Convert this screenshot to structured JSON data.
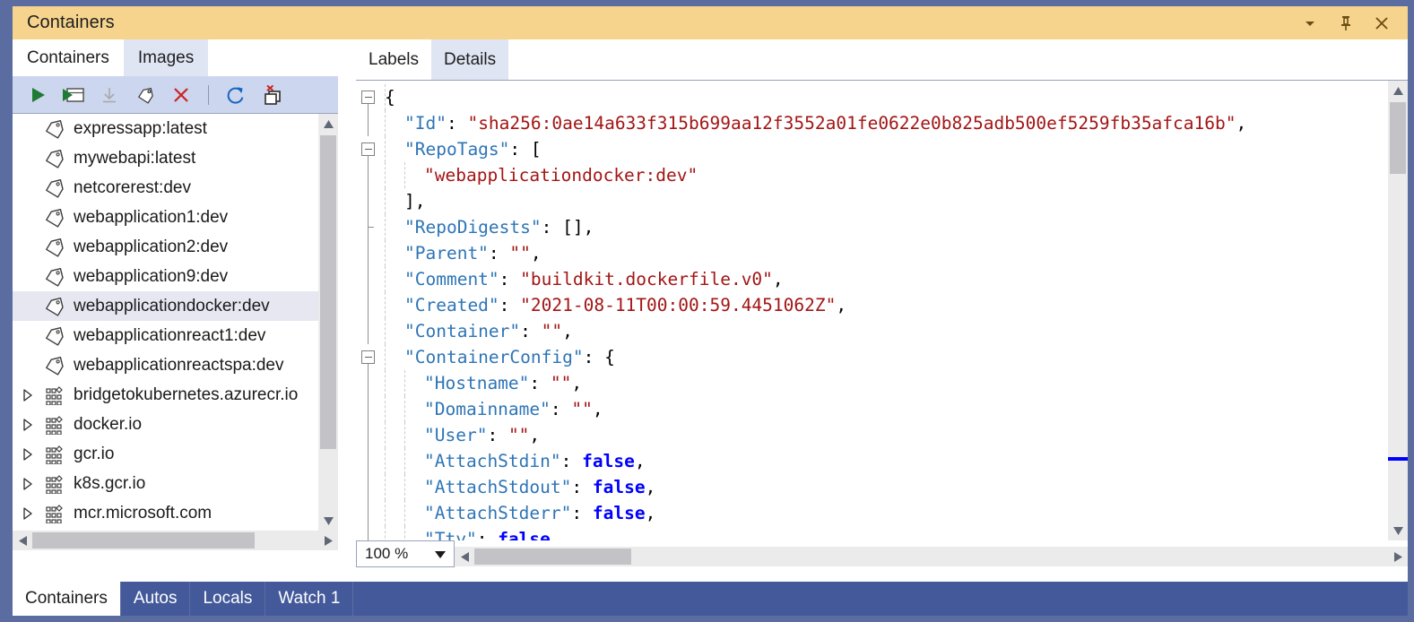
{
  "window": {
    "title": "Containers",
    "controls": [
      {
        "name": "window-dropdown-icon",
        "glyph": "chevron-down-icon",
        "label": "Window options"
      },
      {
        "name": "pin-icon",
        "glyph": "pin-icon",
        "label": "Auto Hide"
      },
      {
        "name": "close-icon",
        "glyph": "close-icon",
        "label": "Close"
      }
    ]
  },
  "left_panel": {
    "tabs": [
      {
        "label": "Containers",
        "active": false
      },
      {
        "label": "Images",
        "active": true
      }
    ],
    "toolbar": [
      {
        "name": "run-button",
        "icon": "play-icon",
        "label": "Run",
        "enabled": true
      },
      {
        "name": "run-interactive-button",
        "icon": "play-window-icon",
        "label": "Run interactive",
        "enabled": true
      },
      {
        "name": "pull-button",
        "icon": "download-arrow-icon",
        "label": "Pull",
        "enabled": false
      },
      {
        "name": "tag-button",
        "icon": "tag-icon",
        "label": "Tag",
        "enabled": true
      },
      {
        "name": "remove-button",
        "icon": "red-x-icon",
        "label": "Remove",
        "enabled": true
      },
      {
        "name": "separator",
        "icon": "separator",
        "label": "",
        "enabled": true
      },
      {
        "name": "refresh-button",
        "icon": "refresh-icon",
        "label": "Refresh",
        "enabled": true
      },
      {
        "name": "prune-button",
        "icon": "prune-images-icon",
        "label": "Prune images",
        "enabled": true
      }
    ],
    "tree": [
      {
        "label": "expressapp:latest",
        "icon": "tag-icon",
        "expandable": false,
        "selected": false
      },
      {
        "label": "mywebapi:latest",
        "icon": "tag-icon",
        "expandable": false,
        "selected": false
      },
      {
        "label": "netcorerest:dev",
        "icon": "tag-icon",
        "expandable": false,
        "selected": false
      },
      {
        "label": "webapplication1:dev",
        "icon": "tag-icon",
        "expandable": false,
        "selected": false
      },
      {
        "label": "webapplication2:dev",
        "icon": "tag-icon",
        "expandable": false,
        "selected": false
      },
      {
        "label": "webapplication9:dev",
        "icon": "tag-icon",
        "expandable": false,
        "selected": false
      },
      {
        "label": "webapplicationdocker:dev",
        "icon": "tag-icon",
        "expandable": false,
        "selected": true
      },
      {
        "label": "webapplicationreact1:dev",
        "icon": "tag-icon",
        "expandable": false,
        "selected": false
      },
      {
        "label": "webapplicationreactspa:dev",
        "icon": "tag-icon",
        "expandable": false,
        "selected": false
      },
      {
        "label": "bridgetokubernetes.azurecr.io",
        "icon": "registry-icon",
        "expandable": true,
        "selected": false
      },
      {
        "label": "docker.io",
        "icon": "registry-icon",
        "expandable": true,
        "selected": false
      },
      {
        "label": "gcr.io",
        "icon": "registry-icon",
        "expandable": true,
        "selected": false
      },
      {
        "label": "k8s.gcr.io",
        "icon": "registry-icon",
        "expandable": true,
        "selected": false
      },
      {
        "label": "mcr.microsoft.com",
        "icon": "registry-icon",
        "expandable": true,
        "selected": false
      }
    ]
  },
  "right_panel": {
    "tabs": [
      {
        "label": "Labels",
        "active": false
      },
      {
        "label": "Details",
        "active": true
      }
    ],
    "zoom": {
      "value": "100 %",
      "options": [
        "100 %"
      ]
    },
    "code_lines": [
      {
        "indent": 0,
        "glyph": "minus",
        "tokens": [
          {
            "t": "{",
            "c": "p"
          }
        ]
      },
      {
        "indent": 1,
        "glyph": "line",
        "tokens": [
          {
            "t": "\"Id\"",
            "c": "k"
          },
          {
            "t": ": ",
            "c": "p"
          },
          {
            "t": "\"sha256:0ae14a633f315b699aa12f3552a01fe0622e0b825adb500ef5259fb35afca16b\"",
            "c": "s"
          },
          {
            "t": ",",
            "c": "p"
          }
        ]
      },
      {
        "indent": 1,
        "glyph": "minus",
        "tokens": [
          {
            "t": "\"RepoTags\"",
            "c": "k"
          },
          {
            "t": ": [",
            "c": "p"
          }
        ]
      },
      {
        "indent": 2,
        "glyph": "line",
        "tokens": [
          {
            "t": "\"webapplicationdocker:dev\"",
            "c": "s"
          }
        ]
      },
      {
        "indent": 1,
        "glyph": "line",
        "tokens": [
          {
            "t": "],",
            "c": "p"
          }
        ]
      },
      {
        "indent": 1,
        "glyph": "tick",
        "tokens": [
          {
            "t": "\"RepoDigests\"",
            "c": "k"
          },
          {
            "t": ": [],",
            "c": "p"
          }
        ]
      },
      {
        "indent": 1,
        "glyph": "line",
        "tokens": [
          {
            "t": "\"Parent\"",
            "c": "k"
          },
          {
            "t": ": ",
            "c": "p"
          },
          {
            "t": "\"\"",
            "c": "s"
          },
          {
            "t": ",",
            "c": "p"
          }
        ]
      },
      {
        "indent": 1,
        "glyph": "line",
        "tokens": [
          {
            "t": "\"Comment\"",
            "c": "k"
          },
          {
            "t": ": ",
            "c": "p"
          },
          {
            "t": "\"buildkit.dockerfile.v0\"",
            "c": "s"
          },
          {
            "t": ",",
            "c": "p"
          }
        ]
      },
      {
        "indent": 1,
        "glyph": "line",
        "tokens": [
          {
            "t": "\"Created\"",
            "c": "k"
          },
          {
            "t": ": ",
            "c": "p"
          },
          {
            "t": "\"2021-08-11T00:00:59.4451062Z\"",
            "c": "s"
          },
          {
            "t": ",",
            "c": "p"
          }
        ]
      },
      {
        "indent": 1,
        "glyph": "line",
        "tokens": [
          {
            "t": "\"Container\"",
            "c": "k"
          },
          {
            "t": ": ",
            "c": "p"
          },
          {
            "t": "\"\"",
            "c": "s"
          },
          {
            "t": ",",
            "c": "p"
          }
        ]
      },
      {
        "indent": 1,
        "glyph": "minus",
        "tokens": [
          {
            "t": "\"ContainerConfig\"",
            "c": "k"
          },
          {
            "t": ": {",
            "c": "p"
          }
        ]
      },
      {
        "indent": 2,
        "glyph": "line",
        "tokens": [
          {
            "t": "\"Hostname\"",
            "c": "k"
          },
          {
            "t": ": ",
            "c": "p"
          },
          {
            "t": "\"\"",
            "c": "s"
          },
          {
            "t": ",",
            "c": "p"
          }
        ]
      },
      {
        "indent": 2,
        "glyph": "line",
        "tokens": [
          {
            "t": "\"Domainname\"",
            "c": "k"
          },
          {
            "t": ": ",
            "c": "p"
          },
          {
            "t": "\"\"",
            "c": "s"
          },
          {
            "t": ",",
            "c": "p"
          }
        ]
      },
      {
        "indent": 2,
        "glyph": "line",
        "tokens": [
          {
            "t": "\"User\"",
            "c": "k"
          },
          {
            "t": ": ",
            "c": "p"
          },
          {
            "t": "\"\"",
            "c": "s"
          },
          {
            "t": ",",
            "c": "p"
          }
        ]
      },
      {
        "indent": 2,
        "glyph": "line",
        "tokens": [
          {
            "t": "\"AttachStdin\"",
            "c": "k"
          },
          {
            "t": ": ",
            "c": "p"
          },
          {
            "t": "false",
            "c": "b"
          },
          {
            "t": ",",
            "c": "p"
          }
        ]
      },
      {
        "indent": 2,
        "glyph": "line",
        "tokens": [
          {
            "t": "\"AttachStdout\"",
            "c": "k"
          },
          {
            "t": ": ",
            "c": "p"
          },
          {
            "t": "false",
            "c": "b"
          },
          {
            "t": ",",
            "c": "p"
          }
        ]
      },
      {
        "indent": 2,
        "glyph": "line",
        "tokens": [
          {
            "t": "\"AttachStderr\"",
            "c": "k"
          },
          {
            "t": ": ",
            "c": "p"
          },
          {
            "t": "false",
            "c": "b"
          },
          {
            "t": ",",
            "c": "p"
          }
        ]
      },
      {
        "indent": 2,
        "glyph": "line",
        "tokens": [
          {
            "t": "\"Tty\"",
            "c": "k"
          },
          {
            "t": ": ",
            "c": "p"
          },
          {
            "t": "false",
            "c": "b"
          }
        ]
      }
    ]
  },
  "bottom_tabs": [
    {
      "label": "Containers",
      "active": true
    },
    {
      "label": "Autos",
      "active": false
    },
    {
      "label": "Locals",
      "active": false
    },
    {
      "label": "Watch 1",
      "active": false
    }
  ],
  "colors": {
    "title_bar": "#f6d48d",
    "frame": "#5b6ca0",
    "active_tab": "#dfe5f3",
    "toolbar": "#ccd6ee",
    "selection": "#e7e7f2",
    "bottom_bar": "#43599a",
    "json_key": "#2e75b6",
    "json_string": "#a31515",
    "json_bool": "#0000ff",
    "marker": "#0000ff"
  }
}
